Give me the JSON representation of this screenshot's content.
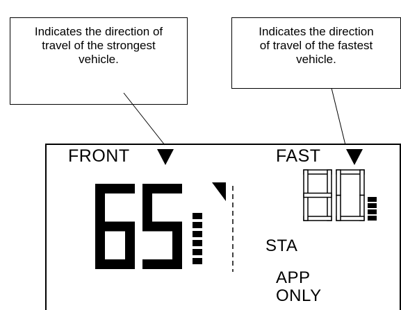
{
  "callouts": {
    "strongest": [
      "Indicates the direction of",
      "travel of the strongest",
      "vehicle."
    ],
    "fastest": [
      "Indicates the direction",
      "of travel of the fastest",
      "vehicle."
    ]
  },
  "display": {
    "front_label": "FRONT",
    "fast_label": "FAST",
    "main_speed": "65",
    "fast_speed": "80",
    "sta_label": "STA",
    "app_label_line1": "APP",
    "app_label_line2": "ONLY"
  },
  "icons": {
    "front_arrow": "down-triangle-icon",
    "fast_arrow": "down-triangle-icon",
    "direction_arrow": "down-triangle-icon"
  }
}
